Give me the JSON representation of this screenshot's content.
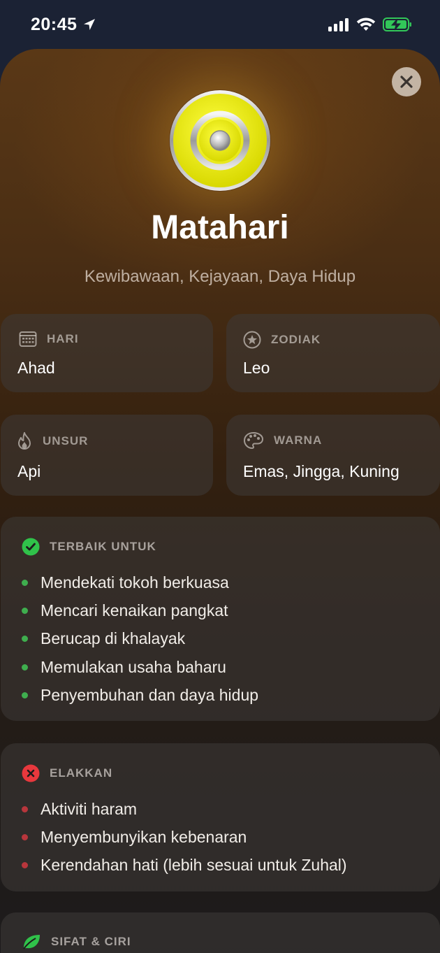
{
  "status_bar": {
    "time": "20:45"
  },
  "planet": {
    "name": "Matahari",
    "subtitle": "Kewibawaan, Kejayaan, Daya Hidup",
    "icon": "sun-planet-icon",
    "accent_color": "#e6e600"
  },
  "info": {
    "hari": {
      "label": "HARI",
      "value": "Ahad",
      "icon": "calendar-icon"
    },
    "zodiak": {
      "label": "ZODIAK",
      "value": "Leo",
      "icon": "star-circle-icon"
    },
    "unsur": {
      "label": "UNSUR",
      "value": "Api",
      "icon": "flame-icon"
    },
    "warna": {
      "label": "WARNA",
      "value": "Emas, Jingga, Kuning",
      "icon": "palette-icon"
    }
  },
  "best_for": {
    "title": "TERBAIK UNTUK",
    "icon": "checkmark-circle-icon",
    "color": "#30c24a",
    "items": [
      "Mendekati tokoh berkuasa",
      "Mencari kenaikan pangkat",
      "Berucap di khalayak",
      "Memulakan usaha baharu",
      "Penyembuhan dan daya hidup"
    ]
  },
  "avoid": {
    "title": "ELAKKAN",
    "icon": "x-circle-icon",
    "color": "#e8383d",
    "items": [
      "Aktiviti haram",
      "Menyembunyikan kebenaran",
      "Kerendahan hati (lebih sesuai untuk Zuhal)"
    ]
  },
  "traits": {
    "title": "SIFAT & CIRI",
    "icon": "leaf-icon"
  }
}
